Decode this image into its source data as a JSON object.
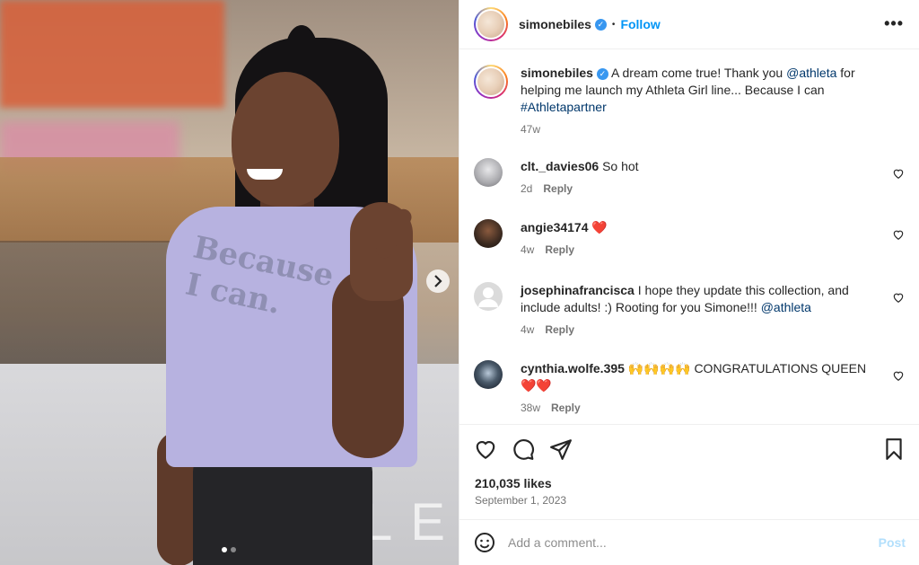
{
  "post": {
    "username": "simonebiles",
    "follow_label": "Follow",
    "more_label": "•••",
    "separator": "•"
  },
  "media": {
    "shirt_text_line1": "Because",
    "shirt_text_line2": "I can.",
    "bg_letters": "LE",
    "next_icon": "chevron-right-icon",
    "slide_count": 2,
    "active_slide": 1
  },
  "caption": {
    "username": "simonebiles",
    "text_before": "A dream come true! Thank you ",
    "mention": "@athleta",
    "text_after": " for helping me launch my Athleta Girl line... Because I can ",
    "hashtag": "#Athletapartner",
    "age": "47w"
  },
  "comments": [
    {
      "username": "clt._davies06",
      "text": "So hot",
      "age": "2d",
      "reply": "Reply"
    },
    {
      "username": "angie34174",
      "text": "❤️",
      "age": "4w",
      "reply": "Reply"
    },
    {
      "username": "josephinafrancisca",
      "text": "I hope they update this collection, and include adults! :) Rooting for you Simone!!! ",
      "mention": "@athleta",
      "age": "4w",
      "reply": "Reply"
    },
    {
      "username": "cynthia.wolfe.395",
      "text": "🙌🙌🙌🙌 CONGRATULATIONS QUEEN ❤️❤️",
      "age": "38w",
      "reply": "Reply"
    }
  ],
  "actions": {
    "likes": "210,035 likes",
    "date": "September 1, 2023"
  },
  "add_comment": {
    "placeholder": "Add a comment...",
    "post_label": "Post"
  },
  "colors": {
    "link": "#00376b",
    "follow": "#0095f6",
    "verified": "#3897f0",
    "heart": "#ed4956"
  }
}
